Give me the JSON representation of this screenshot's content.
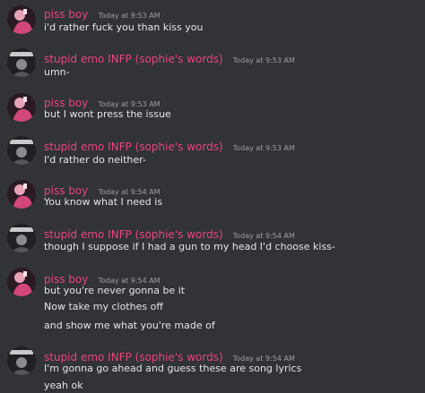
{
  "colors": {
    "background": "#313338",
    "author": "#e8467c",
    "timestamp": "#9ba0a7",
    "message_text": "#e4e5e8"
  },
  "messages": [
    {
      "author": "piss boy",
      "timestamp": "Today at 9:53 AM",
      "avatar": "pink-avatar",
      "lines": [
        "i'd rather fuck you than kiss you"
      ]
    },
    {
      "author": "stupid emo INFP (sophie's words)",
      "timestamp": "Today at 9:53 AM",
      "avatar": "dark-avatar",
      "lines": [
        "umn-"
      ]
    },
    {
      "author": "piss boy",
      "timestamp": "Today at 9:53 AM",
      "avatar": "pink-avatar",
      "lines": [
        "but I wont press the issue"
      ]
    },
    {
      "author": "stupid emo INFP (sophie's words)",
      "timestamp": "Today at 9:53 AM",
      "avatar": "dark-avatar",
      "lines": [
        "I'd rather do neither-"
      ]
    },
    {
      "author": "piss boy",
      "timestamp": "Today at 9:54 AM",
      "avatar": "pink-avatar",
      "lines": [
        "You know what I need is"
      ]
    },
    {
      "author": "stupid emo INFP (sophie's words)",
      "timestamp": "Today at 9:54 AM",
      "avatar": "dark-avatar",
      "lines": [
        "though I suppose if I had a gun to my head I'd choose kiss-"
      ]
    },
    {
      "author": "piss boy",
      "timestamp": "Today at 9:54 AM",
      "avatar": "pink-avatar",
      "lines": [
        "but you're never gonna be it",
        "Now take my clothes off",
        "and show me what you're made of"
      ]
    },
    {
      "author": "stupid emo INFP (sophie's words)",
      "timestamp": "Today at 9:54 AM",
      "avatar": "dark-avatar",
      "lines": [
        "I'm gonna go ahead and guess these are song lyrics",
        "yeah ok"
      ]
    }
  ]
}
